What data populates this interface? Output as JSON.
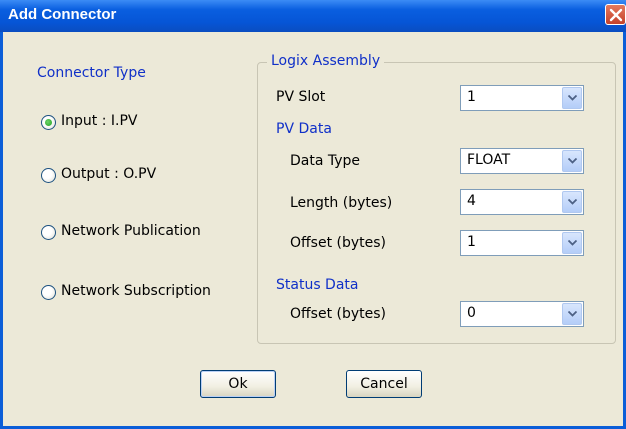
{
  "dialog": {
    "title": "Add Connector"
  },
  "connector_type": {
    "heading": "Connector Type",
    "options": [
      {
        "label": "Input : I.PV",
        "selected": true
      },
      {
        "label": "Output : O.PV",
        "selected": false
      },
      {
        "label": "Network Publication",
        "selected": false
      },
      {
        "label": "Network Subscription",
        "selected": false
      }
    ]
  },
  "logix_assembly": {
    "legend": "Logix Assembly",
    "pv_slot": {
      "label": "PV Slot",
      "value": "1"
    },
    "pv_data": {
      "heading": "PV Data",
      "data_type": {
        "label": "Data Type",
        "value": "FLOAT"
      },
      "length": {
        "label": "Length (bytes)",
        "value": "4"
      },
      "offset": {
        "label": "Offset (bytes)",
        "value": "1"
      }
    },
    "status_data": {
      "heading": "Status Data",
      "offset": {
        "label": "Offset (bytes)",
        "value": "0"
      }
    }
  },
  "buttons": {
    "ok": "Ok",
    "cancel": "Cancel"
  },
  "colors": {
    "titlebar": "#0a5fe0",
    "section_heading": "#1030c8",
    "radio_selected": "#21a121"
  }
}
